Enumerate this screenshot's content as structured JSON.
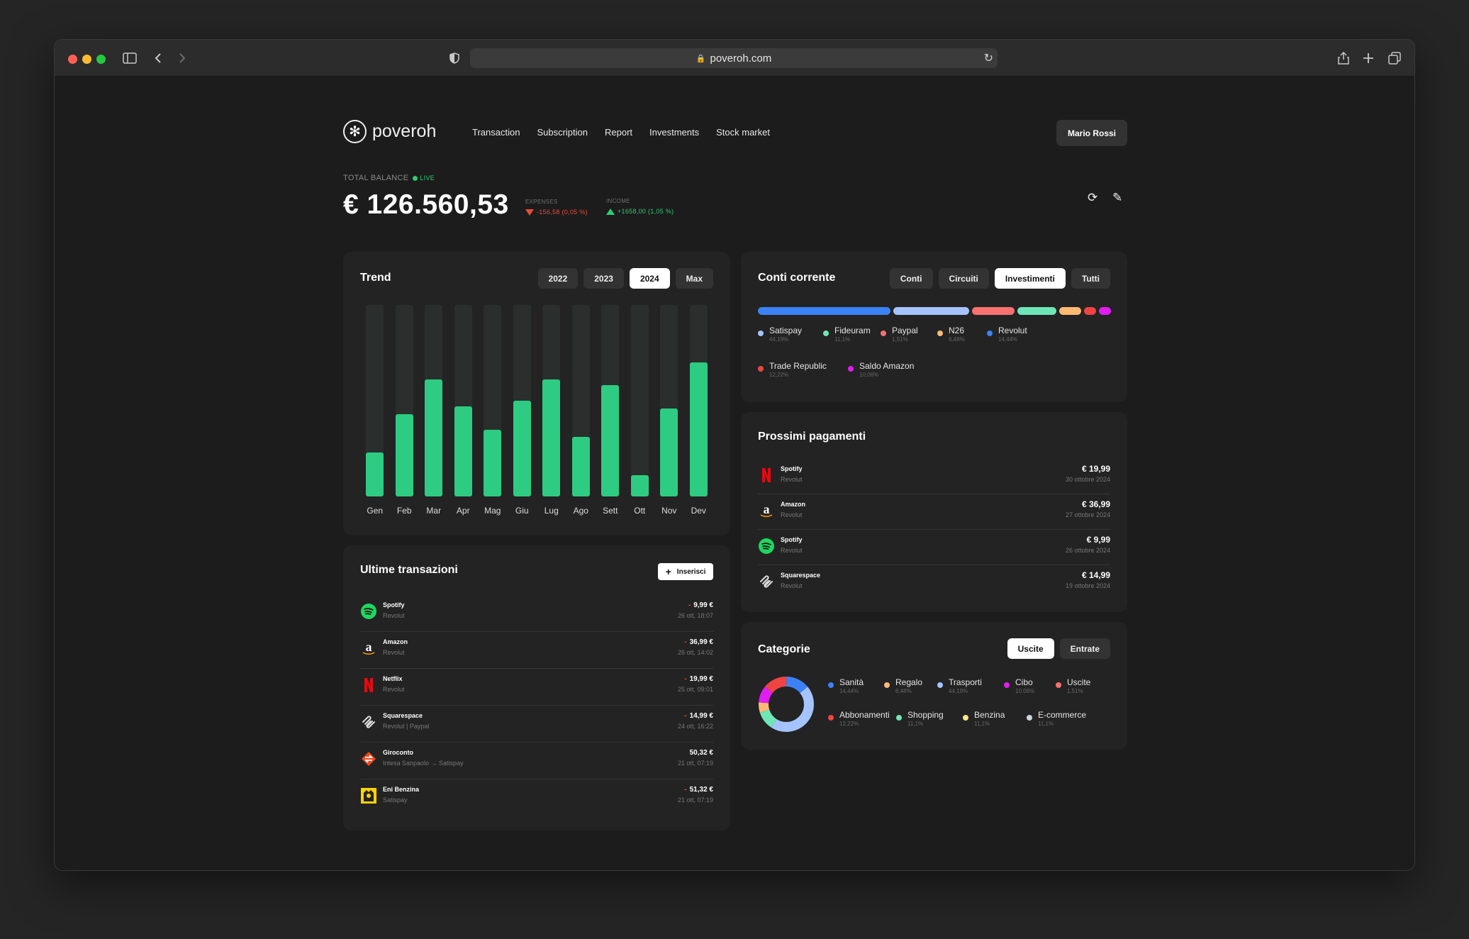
{
  "browser": {
    "url": "poveroh.com"
  },
  "logo": {
    "name": "poveroh"
  },
  "nav": [
    "Transaction",
    "Subscription",
    "Report",
    "Investments",
    "Stock market"
  ],
  "user": {
    "name": "Mario Rossi"
  },
  "balance": {
    "label": "TOTAL BALANCE",
    "live": "LIVE",
    "value": "€ 126.560,53",
    "expenses_label": "EXPENSES",
    "expenses_value": "-156,58 (0,05 %)",
    "income_label": "INCOME",
    "income_value": "+1658,00 (1,05 %)"
  },
  "trend": {
    "title": "Trend",
    "years": [
      "2022",
      "2023",
      "2024",
      "Max"
    ],
    "active_year": "2024"
  },
  "chart_data": {
    "type": "bar",
    "categories": [
      "Gen",
      "Feb",
      "Mar",
      "Apr",
      "Mag",
      "Giu",
      "Lug",
      "Ago",
      "Sett",
      "Ott",
      "Nov",
      "Dev"
    ],
    "values": [
      23,
      43,
      61,
      47,
      35,
      50,
      61,
      31,
      58,
      11,
      46,
      70
    ],
    "ylim": [
      0,
      100
    ],
    "colors": {
      "fill": "#2ecc82",
      "track": "#2a2e2c"
    }
  },
  "transactions": {
    "title": "Ultime transazioni",
    "add_label": "Inserisci",
    "items": [
      {
        "name": "Spotify",
        "sub": "Revolut",
        "amount": "9,99 €",
        "date": "26 ott, 18:07",
        "negative": true,
        "icon": "spotify-icon"
      },
      {
        "name": "Amazon",
        "sub": "Revolut",
        "amount": "36,99 €",
        "date": "26 ott, 14:02",
        "negative": true,
        "icon": "amazon-icon"
      },
      {
        "name": "Netflix",
        "sub": "Revolut",
        "amount": "19,99 €",
        "date": "25 ott, 09:01",
        "negative": true,
        "icon": "netflix-icon"
      },
      {
        "name": "Squarespace",
        "sub": "Revolut | Paypal",
        "amount": "14,99 €",
        "date": "24 ott, 16:22",
        "negative": true,
        "icon": "squarespace-icon"
      },
      {
        "name": "Giroconto",
        "sub": "Intesa Sanpaolo → Satispay",
        "amount": "50,32 €",
        "date": "21 ott, 07:19",
        "negative": false,
        "icon": "transfer-icon"
      },
      {
        "name": "Eni Benzina",
        "sub": "Satispay",
        "amount": "51,32 €",
        "date": "21 ott, 07:19",
        "negative": true,
        "icon": "eni-icon"
      }
    ]
  },
  "accounts": {
    "title": "Conti corrente",
    "tabs": [
      "Conti",
      "Circuiti",
      "Investimenti",
      "Tutti"
    ],
    "active_tab": "Investimenti",
    "items": [
      {
        "name": "Satispay",
        "pct": "44,19%",
        "color": "#3b82f6",
        "share": 44.19
      },
      {
        "name": "Fideuram",
        "pct": "11,1%",
        "color": "#a5c4ff",
        "share": 25.5
      },
      {
        "name": "Paypal",
        "pct": "1,51%",
        "color": "#f87171",
        "share": 14
      },
      {
        "name": "N26",
        "pct": "6,48%",
        "color": "#6ee7b7",
        "share": 13
      },
      {
        "name": "Revolut",
        "pct": "14,44%",
        "color": "#fdba74",
        "share": 7.5
      },
      {
        "name": "Trade Republic",
        "pct": "12,22%",
        "color": "#ef4444",
        "share": 4
      },
      {
        "name": "Saldo Amazon",
        "pct": "10,06%",
        "color": "#e11df0",
        "share": 4
      }
    ],
    "legend_colors": [
      "#a5c4ff",
      "#6ee7b7",
      "#f87171",
      "#fdba74",
      "#3b82f6",
      "#ef4444",
      "#e11df0"
    ]
  },
  "payments": {
    "title": "Prossimi pagamenti",
    "items": [
      {
        "name": "Spotify",
        "sub": "Revolut",
        "amount": "€ 19,99",
        "date": "30 ottobre 2024",
        "icon": "netflix-icon"
      },
      {
        "name": "Amazon",
        "sub": "Revolut",
        "amount": "€ 36,99",
        "date": "27 ottobre 2024",
        "icon": "amazon-icon"
      },
      {
        "name": "Spotify",
        "sub": "Revolut",
        "amount": "€ 9,99",
        "date": "26 ottobre 2024",
        "icon": "spotify-icon"
      },
      {
        "name": "Squarespace",
        "sub": "Revolut",
        "amount": "€ 14,99",
        "date": "19 ottobre 2024",
        "icon": "squarespace-icon"
      }
    ]
  },
  "categories": {
    "title": "Categorie",
    "tabs": [
      "Uscite",
      "Entrate"
    ],
    "active_tab": "Uscite",
    "items": [
      {
        "name": "Sanità",
        "pct": "14,44%",
        "color": "#3b82f6"
      },
      {
        "name": "Regalo",
        "pct": "6,48%",
        "color": "#fdba74"
      },
      {
        "name": "Trasporti",
        "pct": "44,19%",
        "color": "#a5c4ff"
      },
      {
        "name": "Cibo",
        "pct": "10,06%",
        "color": "#e11df0"
      },
      {
        "name": "Uscite",
        "pct": "1,51%",
        "color": "#f87171"
      },
      {
        "name": "Abbonamenti",
        "pct": "12,22%",
        "color": "#ef4444"
      },
      {
        "name": "Shopping",
        "pct": "11,1%",
        "color": "#6ee7b7"
      },
      {
        "name": "Benzina",
        "pct": "11,1%",
        "color": "#fde68a"
      },
      {
        "name": "E-commerce",
        "pct": "11,1%",
        "color": "#cbd5e1"
      }
    ],
    "donut": [
      {
        "color": "#3b82f6",
        "value": 14
      },
      {
        "color": "#a5c4ff",
        "value": 45
      },
      {
        "color": "#6ee7b7",
        "value": 11
      },
      {
        "color": "#fdba74",
        "value": 6
      },
      {
        "color": "#e11df0",
        "value": 10
      },
      {
        "color": "#ef4444",
        "value": 14
      }
    ]
  }
}
